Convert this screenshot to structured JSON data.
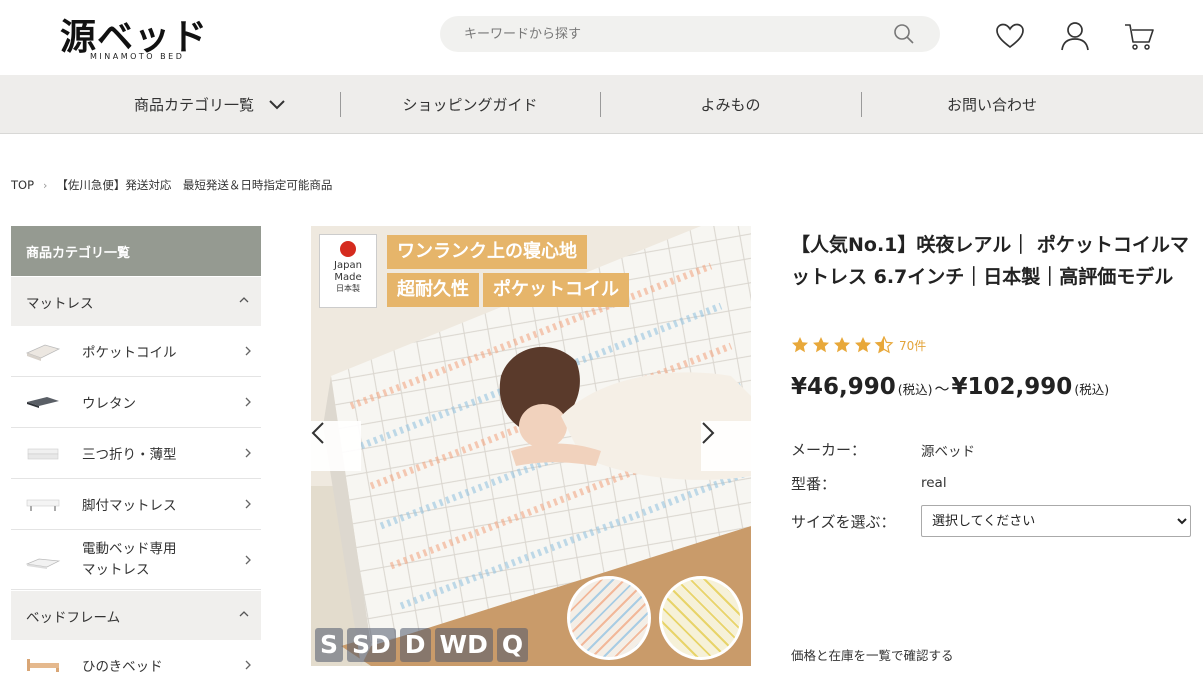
{
  "header": {
    "logo_text": "源ベッド",
    "logo_sub": "MINAMOTO BED",
    "search_placeholder": "キーワードから探す",
    "icons": [
      "search-icon",
      "heart-icon",
      "user-icon",
      "cart-icon"
    ]
  },
  "nav": {
    "items": [
      {
        "label": "商品カテゴリ一覧"
      },
      {
        "label": "ショッピングガイド"
      },
      {
        "label": "よみもの"
      },
      {
        "label": "お問い合わせ"
      }
    ]
  },
  "breadcrumb": {
    "items": [
      "TOP",
      "【佐川急便】発送対応　最短発送＆日時指定可能商品"
    ]
  },
  "sidebar": {
    "title": "商品カテゴリ一覧",
    "sections": [
      {
        "label": "マットレス",
        "items": [
          {
            "label": "ポケットコイル"
          },
          {
            "label": "ウレタン"
          },
          {
            "label": "三つ折り・薄型"
          },
          {
            "label": "脚付マットレス"
          },
          {
            "label_line1": "電動ベッド専用",
            "label_line2": "マットレス"
          }
        ]
      },
      {
        "label": "ベッドフレーム",
        "items": [
          {
            "label": "ひのきベッド"
          }
        ]
      }
    ]
  },
  "gallery": {
    "badge_line1": "Japan",
    "badge_line2": "Made",
    "badge_line3": "日本製",
    "ribbon1": "ワンランク上の寝心地",
    "ribbon2": "超耐久性",
    "ribbon3": "ポケットコイル",
    "sizes": [
      "S",
      "SD",
      "D",
      "WD",
      "Q"
    ]
  },
  "product": {
    "title": "【人気No.1】咲夜レアル｜ ポケットコイルマットレス 6.7インチ｜日本製｜高評価モデル",
    "rating": 4.5,
    "review_count": "70件",
    "price_low": "¥46,990",
    "price_high": "¥102,990",
    "tax_label": "(税込)",
    "tilde": "～",
    "maker_label": "メーカー：",
    "maker_value": "源ベッド",
    "model_label": "型番：",
    "model_value": "real",
    "size_label": "サイズを選ぶ：",
    "size_select_value": "選択してください",
    "stock_link": "価格と在庫を一覧で確認する"
  },
  "colors": {
    "nav_bg": "#eeedeb",
    "sidebar_head": "#959a91",
    "star": "#e8a83a",
    "ribbon": "#e6b56a"
  }
}
